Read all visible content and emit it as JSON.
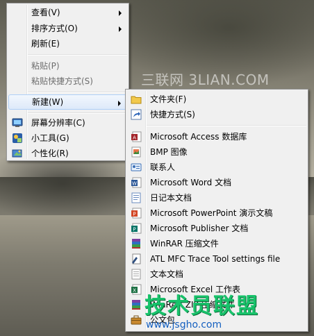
{
  "watermark": {
    "text": "三联网 3LIAN.COM",
    "brand": "技术员联盟",
    "url": "www.jsgho.com"
  },
  "context_menu": {
    "items": [
      {
        "label": "查看(V)",
        "submenu": true
      },
      {
        "label": "排序方式(O)",
        "submenu": true
      },
      {
        "label": "刷新(E)"
      },
      {
        "label": "粘贴(P)",
        "disabled": true
      },
      {
        "label": "粘贴快捷方式(S)",
        "disabled": true
      },
      {
        "label": "新建(W)",
        "submenu": true,
        "highlighted": true
      },
      {
        "label": "屏幕分辨率(C)",
        "icon": "monitor-icon"
      },
      {
        "label": "小工具(G)",
        "icon": "gadgets-icon"
      },
      {
        "label": "个性化(R)",
        "icon": "personalize-icon"
      }
    ]
  },
  "new_submenu": {
    "items": [
      {
        "label": "文件夹(F)",
        "icon": "folder-icon"
      },
      {
        "label": "快捷方式(S)",
        "icon": "shortcut-icon"
      },
      {
        "label": "Microsoft Access 数据库",
        "icon": "access-icon"
      },
      {
        "label": "BMP 图像",
        "icon": "bmp-icon"
      },
      {
        "label": "联系人",
        "icon": "contact-icon"
      },
      {
        "label": "Microsoft Word 文档",
        "icon": "word-icon"
      },
      {
        "label": "日记本文档",
        "icon": "journal-icon"
      },
      {
        "label": "Microsoft PowerPoint 演示文稿",
        "icon": "powerpoint-icon"
      },
      {
        "label": "Microsoft Publisher 文档",
        "icon": "publisher-icon"
      },
      {
        "label": "WinRAR 压缩文件",
        "icon": "winrar-icon"
      },
      {
        "label": "ATL MFC Trace Tool settings file",
        "icon": "settings-file-icon"
      },
      {
        "label": "文本文档",
        "icon": "text-document-icon"
      },
      {
        "label": "Microsoft Excel 工作表",
        "icon": "excel-icon"
      },
      {
        "label": "WinRAR ZIP 压缩文件",
        "icon": "winrar-zip-icon"
      },
      {
        "label": "公文包",
        "icon": "briefcase-icon"
      }
    ]
  }
}
